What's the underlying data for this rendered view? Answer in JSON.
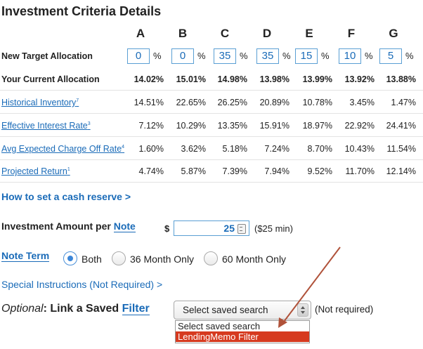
{
  "title": "Investment Criteria Details",
  "grades": [
    "A",
    "B",
    "C",
    "D",
    "E",
    "F",
    "G"
  ],
  "rows": {
    "target": {
      "label": "New Target Allocation",
      "values": [
        "0",
        "0",
        "35",
        "35",
        "15",
        "10",
        "5"
      ],
      "unit": "%"
    },
    "current": {
      "label": "Your Current Allocation",
      "values": [
        "14.02%",
        "15.01%",
        "14.98%",
        "13.98%",
        "13.99%",
        "13.92%",
        "13.88%"
      ]
    },
    "historical": {
      "label": "Historical Inventory",
      "sup": "7",
      "values": [
        "14.51%",
        "22.65%",
        "26.25%",
        "20.89%",
        "10.78%",
        "3.45%",
        "1.47%"
      ]
    },
    "interest": {
      "label": "Effective Interest Rate",
      "sup": "3",
      "values": [
        "7.12%",
        "10.29%",
        "13.35%",
        "15.91%",
        "18.97%",
        "22.92%",
        "24.41%"
      ]
    },
    "chargeoff": {
      "label": "Avg Expected Charge Off Rate",
      "sup": "4",
      "values": [
        "1.60%",
        "3.62%",
        "5.18%",
        "7.24%",
        "8.70%",
        "10.43%",
        "11.54%"
      ]
    },
    "projected": {
      "label": "Projected Return",
      "sup": "1",
      "values": [
        "4.74%",
        "5.87%",
        "7.39%",
        "7.94%",
        "9.52%",
        "11.70%",
        "12.14%"
      ]
    }
  },
  "cash_reserve_link": "How to set a cash reserve >",
  "investment": {
    "label": "Investment Amount per ",
    "link": "Note",
    "currency": "$",
    "value": "25",
    "min_note": "($25 min)"
  },
  "note_term": {
    "label": "Note Term",
    "options": [
      "Both",
      "36 Month Only",
      "60 Month Only"
    ],
    "selected": "Both"
  },
  "special_instructions": "Special Instructions (Not Required) >",
  "saved_filter": {
    "optional": "Optional",
    "label": ": Link a Saved ",
    "link": "Filter",
    "selected": "Select saved search",
    "not_required": "(Not required)",
    "options": [
      "Select saved search",
      "LendingMemo Filter"
    ],
    "highlighted": "LendingMemo Filter"
  },
  "colors": {
    "link": "#1a6bb8",
    "highlight": "#d63a1f",
    "annotation_arrow": "#b0523a"
  }
}
